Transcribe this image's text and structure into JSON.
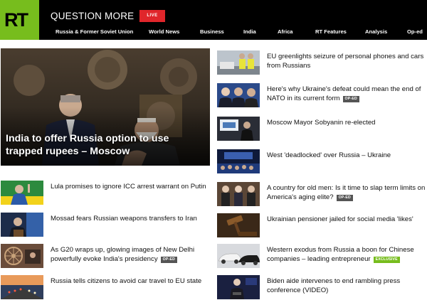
{
  "header": {
    "logo_text": "RT",
    "tagline": "QUESTION MORE",
    "live_label": "LIVE",
    "nav": [
      "Russia & Former Soviet Union",
      "World News",
      "Business",
      "India",
      "Africa",
      "RT Features",
      "Analysis",
      "Op-ed"
    ]
  },
  "hero": {
    "title": "India to offer Russia option to use trapped rupees – Moscow"
  },
  "left_stories": [
    {
      "title": "Lula promises to ignore ICC arrest warrant on Putin",
      "badge": ""
    },
    {
      "title": "Mossad fears Russian weapons transfers to Iran",
      "badge": ""
    },
    {
      "title": "As G20 wraps up, glowing images of New Delhi powerfully evoke India's presidency",
      "badge": "OP-ED"
    },
    {
      "title": "Russia tells citizens to avoid car travel to EU state",
      "badge": ""
    }
  ],
  "right_stories": [
    {
      "title": "EU greenlights seizure of personal phones and cars from Russians",
      "badge": ""
    },
    {
      "title": "Here's why Ukraine's defeat could mean the end of NATO in its current form",
      "badge": "OP-ED"
    },
    {
      "title": "Moscow Mayor Sobyanin re-elected",
      "badge": ""
    },
    {
      "title": "West 'deadlocked' over Russia – Ukraine",
      "badge": ""
    },
    {
      "title": "A country for old men: Is it time to slap term limits on America's aging elite?",
      "badge": "OP-ED"
    },
    {
      "title": "Ukrainian pensioner jailed for social media 'likes'",
      "badge": ""
    },
    {
      "title": "Western exodus from Russia a boon for Chinese companies – leading entrepreneur",
      "badge": "EXCLUSIVE"
    },
    {
      "title": "Biden aide intervenes to end rambling press conference (VIDEO)",
      "badge": ""
    }
  ],
  "colors": {
    "brand_green": "#77bd1d",
    "live_red": "#e0262b",
    "header_bg": "#000000"
  }
}
